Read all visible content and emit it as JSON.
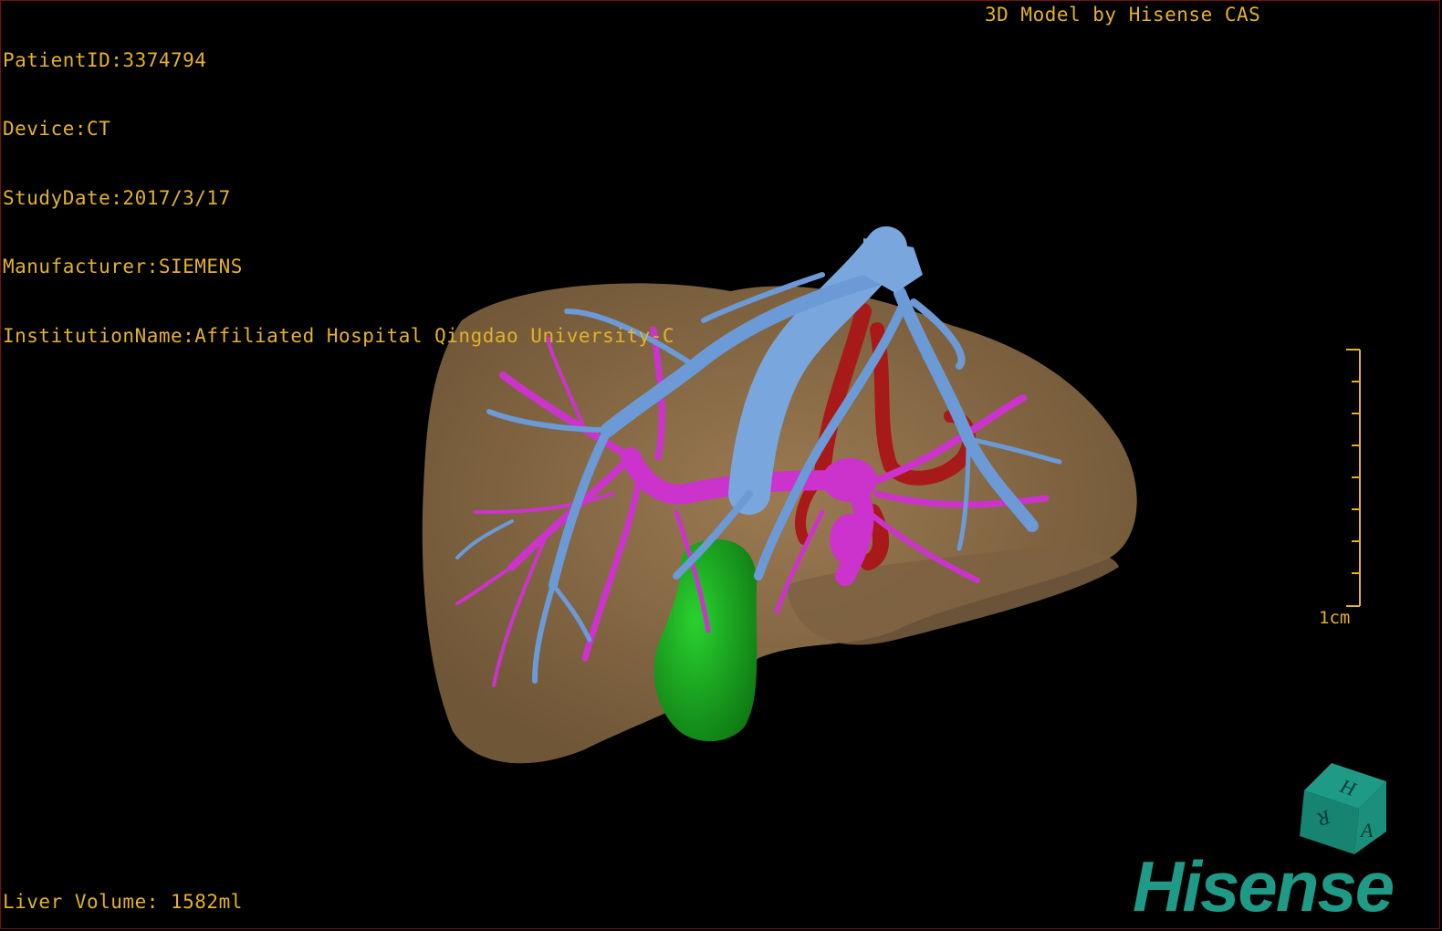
{
  "header": {
    "patient_id": "PatientID:3374794",
    "device": "Device:CT",
    "study_date": "StudyDate:2017/3/17",
    "manufacturer": "Manufacturer:SIEMENS",
    "institution": "InstitutionName:Affiliated Hospital Qingdao University-C",
    "brand_title": "3D Model by Hisense CAS"
  },
  "footer": {
    "liver_volume": "Liver Volume: 1582ml"
  },
  "scale": {
    "label": "1cm"
  },
  "orientation_cube": {
    "faces": [
      "H",
      "A",
      "R"
    ]
  },
  "logo": {
    "text": "Hisense"
  },
  "colors": {
    "text": "#e3b12a",
    "liver": "#8a6d4a",
    "hepatic_vein": "#6b9ad6",
    "portal_vein": "#cc33cc",
    "artery": "#a81a1a",
    "gallbladder": "#19a81f",
    "brand": "#1f9a86"
  }
}
